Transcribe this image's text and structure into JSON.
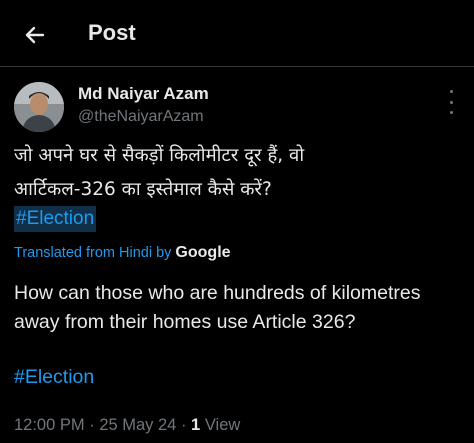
{
  "header": {
    "back_icon": "arrow-left-icon",
    "title": "Post"
  },
  "post": {
    "author": {
      "name": "Md Naiyar Azam",
      "handle": "@theNaiyarAzam"
    },
    "more_icon": "more-vertical-icon",
    "original_text_line1": "जो अपने घर से सैकड़ों किलोमीटर दूर हैं, वो",
    "original_text_line2": "आर्टिकल-326 का इस्तेमाल कैसे करें?",
    "original_hashtag": "#Election",
    "translated_from": "Translated from Hindi by",
    "translator": "Google",
    "translated_text": "How can those who are hundreds of kilometres away from their homes use Article 326?",
    "translated_hashtag": "#Election",
    "time": "12:00 PM",
    "separator": "·",
    "date": "25 May 24",
    "view_count": "1",
    "view_label": "View"
  },
  "colors": {
    "background": "#000000",
    "text": "#e7e9ea",
    "secondary": "#71767b",
    "accent": "#1d9bf0",
    "divider": "#2f3336"
  }
}
